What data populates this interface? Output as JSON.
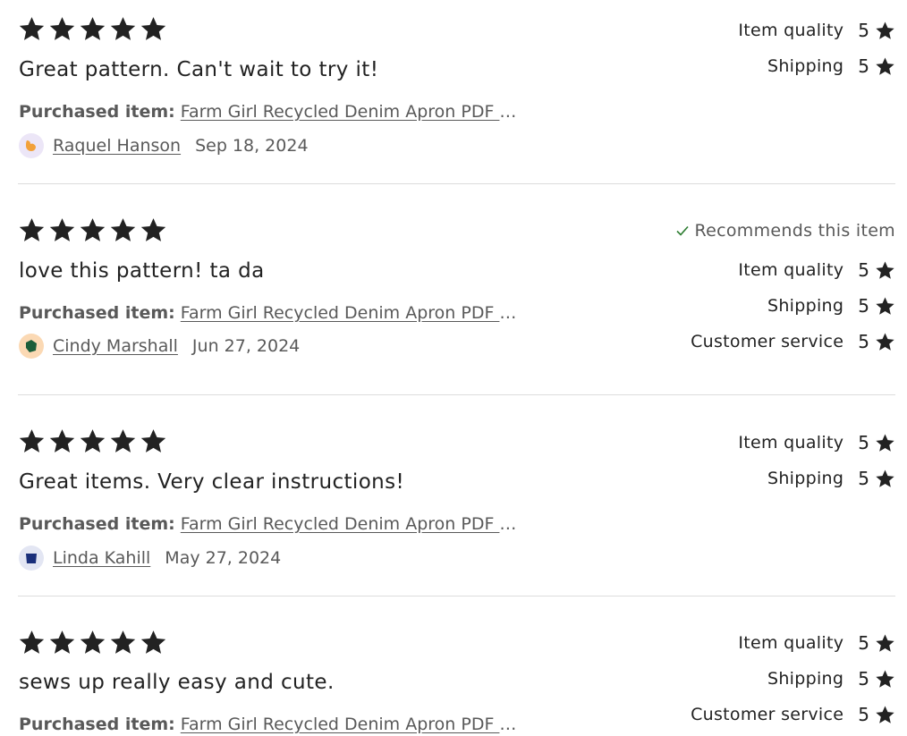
{
  "colors": {
    "star": "#222222",
    "check": "#2e7d32",
    "muted": "#595959"
  },
  "purchased_label": "Purchased item:",
  "reviews": [
    {
      "rating": 5,
      "text": "Great pattern. Can't wait to try it!",
      "item": "Farm Girl Recycled Denim Apron PDF D...",
      "author": "Raquel Hanson",
      "date": "Sep 18, 2024",
      "avatar_icon": "orange-bird-avatar-icon",
      "recommends": null,
      "ratings": [
        {
          "label": "Item quality",
          "value": "5"
        },
        {
          "label": "Shipping",
          "value": "5"
        }
      ]
    },
    {
      "rating": 5,
      "text": "love this pattern! ta da",
      "item": "Farm Girl Recycled Denim Apron PDF D...",
      "author": "Cindy Marshall",
      "date": "Jun 27, 2024",
      "avatar_icon": "green-leaf-avatar-icon",
      "recommends": "Recommends this item",
      "ratings": [
        {
          "label": "Item quality",
          "value": "5"
        },
        {
          "label": "Shipping",
          "value": "5"
        },
        {
          "label": "Customer service",
          "value": "5"
        }
      ]
    },
    {
      "rating": 5,
      "text": "Great items. Very clear instructions!",
      "item": "Farm Girl Recycled Denim Apron PDF D...",
      "author": "Linda Kahill",
      "date": "May 27, 2024",
      "avatar_icon": "blue-bag-avatar-icon",
      "recommends": null,
      "ratings": [
        {
          "label": "Item quality",
          "value": "5"
        },
        {
          "label": "Shipping",
          "value": "5"
        }
      ]
    },
    {
      "rating": 5,
      "text": "sews up really easy and cute.",
      "item": "Farm Girl Recycled Denim Apron PDF D...",
      "author": "",
      "date": "",
      "avatar_icon": "",
      "recommends": null,
      "ratings": [
        {
          "label": "Item quality",
          "value": "5"
        },
        {
          "label": "Shipping",
          "value": "5"
        },
        {
          "label": "Customer service",
          "value": "5"
        }
      ]
    }
  ]
}
